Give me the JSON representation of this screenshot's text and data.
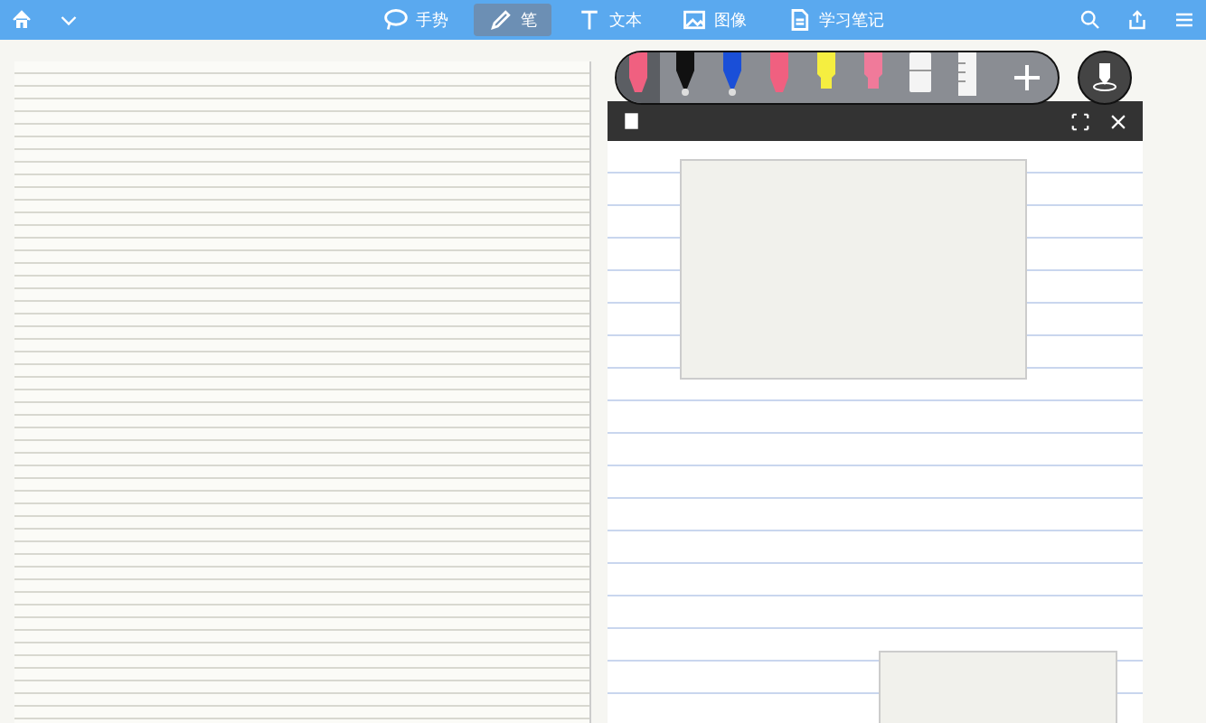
{
  "toolbar": {
    "tools": [
      {
        "kind": "lasso",
        "label": "手势",
        "selected": false
      },
      {
        "kind": "pen",
        "label": "笔",
        "selected": true
      },
      {
        "kind": "text",
        "label": "文本",
        "selected": false
      },
      {
        "kind": "image",
        "label": "图像",
        "selected": false
      },
      {
        "kind": "note",
        "label": "学习笔记",
        "selected": false
      }
    ]
  },
  "pen_palette": {
    "pens": [
      {
        "kind": "marker",
        "color": "#f06080",
        "selected": true
      },
      {
        "kind": "pen",
        "color": "#111111",
        "selected": false
      },
      {
        "kind": "pen",
        "color": "#1a4fd8",
        "selected": false
      },
      {
        "kind": "marker",
        "color": "#f06080",
        "selected": false
      },
      {
        "kind": "highlighter",
        "color": "#f5ee40",
        "selected": false
      },
      {
        "kind": "highlighter",
        "color": "#f07a9a",
        "selected": false
      },
      {
        "kind": "eraser",
        "color": "#f4f4f4",
        "selected": false
      },
      {
        "kind": "ruler",
        "color": "#f4f4f4",
        "selected": false
      }
    ]
  }
}
